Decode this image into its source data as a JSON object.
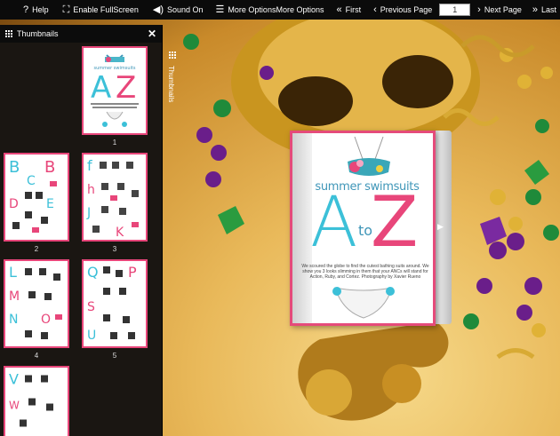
{
  "toolbar": {
    "help": "Help",
    "fullscreen": "Enable FullScreen",
    "sound": "Sound On",
    "more_options_1": "More Options",
    "more_options_2": "More Options",
    "first": "First",
    "previous": "Previous Page",
    "page_value": "1",
    "next": "Next Page",
    "last": "Last"
  },
  "panel": {
    "title": "Thumbnails",
    "close": "✕",
    "thumbnails": [
      {
        "number": "1"
      },
      {
        "number": "2"
      },
      {
        "number": "3"
      },
      {
        "number": "4"
      },
      {
        "number": "5"
      },
      {
        "number": ""
      }
    ]
  },
  "sidetab": {
    "label": "Thumbnails"
  },
  "page": {
    "title": "summer swimsuits",
    "letter_a": "A",
    "letter_to": "to",
    "letter_z": "Z",
    "blurb": "We scoured the globe to find the cutest bathing suits around. We show you 3 looks slimming in them that your ANCs will stand for Action, Ruby, and Cortez. Photography by Xavier Rueno"
  },
  "colors": {
    "accent_pink": "#e8467a",
    "accent_teal": "#3cc0d8",
    "toolbar_bg": "#0b0b0b",
    "panel_bg": "#1a1612"
  }
}
